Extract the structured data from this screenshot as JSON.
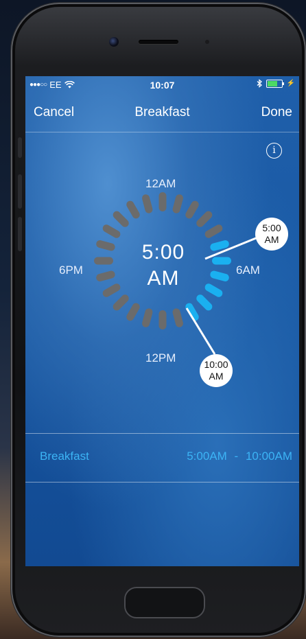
{
  "status_bar": {
    "signal": "●●●○○",
    "carrier": "EE",
    "wifi_icon": "wifi-icon",
    "time": "10:07",
    "bluetooth_icon": "bluetooth-icon",
    "charging": "⚡",
    "battery_level": 0.7
  },
  "navbar": {
    "cancel_label": "Cancel",
    "title": "Breakfast",
    "done_label": "Done"
  },
  "info_button": {
    "glyph": "i"
  },
  "clock": {
    "label_top": "12AM",
    "label_right": "6AM",
    "label_bottom": "12PM",
    "label_left": "6PM",
    "center_time": "5:00",
    "center_meridiem": "AM",
    "segments_total": 24,
    "selected_start_hour": 5,
    "selected_end_hour": 10,
    "colors": {
      "inactive": "#6b6b6b",
      "active": "#1ab0f0"
    }
  },
  "handles": {
    "start": {
      "time": "5:00",
      "meridiem": "AM"
    },
    "end": {
      "time": "10:00",
      "meridiem": "AM"
    }
  },
  "meal_row": {
    "name": "Breakfast",
    "start": "5:00AM",
    "separator": "-",
    "end": "10:00AM"
  }
}
